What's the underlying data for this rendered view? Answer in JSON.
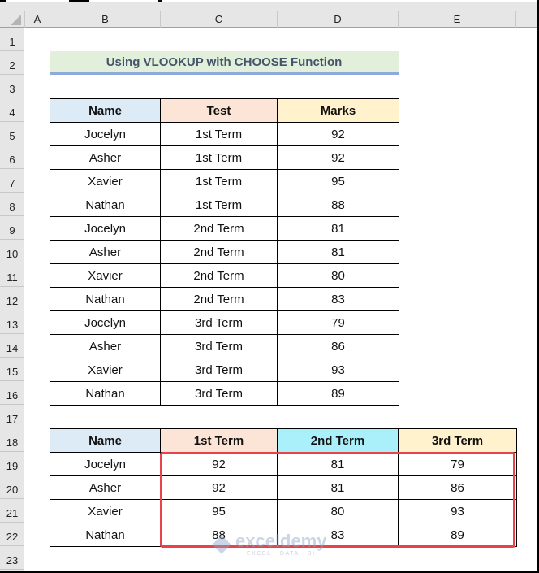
{
  "columns": [
    "A",
    "B",
    "C",
    "D",
    "E"
  ],
  "rows": [
    "1",
    "2",
    "3",
    "4",
    "5",
    "6",
    "7",
    "8",
    "9",
    "10",
    "11",
    "12",
    "13",
    "14",
    "15",
    "16",
    "17",
    "18",
    "19",
    "20",
    "21",
    "22",
    "23"
  ],
  "title": "Using VLOOKUP with CHOOSE Function",
  "source_table": {
    "headers": [
      "Name",
      "Test",
      "Marks"
    ],
    "rows": [
      [
        "Jocelyn",
        "1st Term",
        "92"
      ],
      [
        "Asher",
        "1st Term",
        "92"
      ],
      [
        "Xavier",
        "1st Term",
        "95"
      ],
      [
        "Nathan",
        "1st Term",
        "88"
      ],
      [
        "Jocelyn",
        "2nd Term",
        "81"
      ],
      [
        "Asher",
        "2nd Term",
        "81"
      ],
      [
        "Xavier",
        "2nd Term",
        "80"
      ],
      [
        "Nathan",
        "2nd Term",
        "83"
      ],
      [
        "Jocelyn",
        "3rd Term",
        "79"
      ],
      [
        "Asher",
        "3rd Term",
        "86"
      ],
      [
        "Xavier",
        "3rd Term",
        "93"
      ],
      [
        "Nathan",
        "3rd Term",
        "89"
      ]
    ]
  },
  "result_table": {
    "headers": [
      "Name",
      "1st Term",
      "2nd Term",
      "3rd Term"
    ],
    "rows": [
      [
        "Jocelyn",
        "92",
        "81",
        "79"
      ],
      [
        "Asher",
        "92",
        "81",
        "86"
      ],
      [
        "Xavier",
        "95",
        "80",
        "93"
      ],
      [
        "Nathan",
        "88",
        "83",
        "89"
      ]
    ]
  },
  "watermark": {
    "brand": "exceldemy",
    "tagline": "EXCEL · DATA · BI"
  },
  "colors": {
    "highlight": "#e8434a",
    "title_fill": "#e2efda",
    "name_header": "#ddebf7",
    "test_header": "#fce4d6",
    "marks_header": "#fff2cc",
    "term2_header": "#a9f0fb"
  }
}
